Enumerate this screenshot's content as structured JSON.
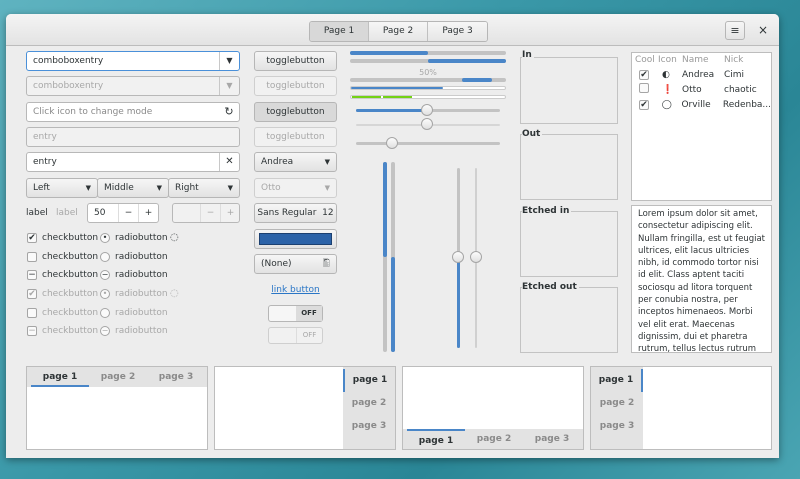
{
  "header": {
    "tabs": [
      "Page 1",
      "Page 2",
      "Page 3"
    ],
    "active_tab": 0,
    "menu_icon": "hamburger-menu-icon",
    "close_label": "×"
  },
  "col1": {
    "combo_entry": "comboboxentry",
    "combo_entry_disabled": "comboboxentry",
    "mode_entry_placeholder": "Click icon to change mode",
    "disabled_entry": "entry",
    "entry": "entry",
    "linked": [
      "Left",
      "Middle",
      "Right"
    ],
    "label1": "label",
    "label2": "label",
    "spin_value": "50",
    "spin_minus": "−",
    "spin_plus": "+",
    "checks": [
      {
        "label": "checkbutton",
        "state": "checked",
        "radio": "radiobutton",
        "radio_state": "checked",
        "spinner": true,
        "disabled": false
      },
      {
        "label": "checkbutton",
        "state": "unchecked",
        "radio": "radiobutton",
        "radio_state": "unchecked",
        "spinner": false,
        "disabled": false
      },
      {
        "label": "checkbutton",
        "state": "mixed",
        "radio": "radiobutton",
        "radio_state": "mixed",
        "spinner": false,
        "disabled": false
      },
      {
        "label": "checkbutton",
        "state": "checked",
        "radio": "radiobutton",
        "radio_state": "checked",
        "spinner": true,
        "disabled": true
      },
      {
        "label": "checkbutton",
        "state": "unchecked",
        "radio": "radiobutton",
        "radio_state": "unchecked",
        "spinner": false,
        "disabled": true
      },
      {
        "label": "checkbutton",
        "state": "mixed",
        "radio": "radiobutton",
        "radio_state": "mixed",
        "spinner": false,
        "disabled": true
      }
    ]
  },
  "col2": {
    "toggles": [
      "togglebutton",
      "togglebutton",
      "togglebutton",
      "togglebutton"
    ],
    "combo1": "Andrea",
    "combo2": "Otto",
    "font_name": "Sans Regular",
    "font_size": "12",
    "color": "#2c63a8",
    "file": "(None)",
    "link": "link button",
    "switch1": "OFF",
    "switch2": "OFF"
  },
  "col3": {
    "progress_label": "50%",
    "progress1": 0.5,
    "progress2": 0.5,
    "scale1": 0.5,
    "scale2": 0.5,
    "scale3": 0.25,
    "vscale1": 0.5,
    "vscale2": 0.5,
    "vscale3": 0.5,
    "vscale4": 0.5
  },
  "frames": [
    "In",
    "Out",
    "Etched in",
    "Etched out"
  ],
  "tree": {
    "columns": [
      "Cool",
      "Icon",
      "Name",
      "Nick"
    ],
    "rows": [
      {
        "cool": true,
        "icon": "◐",
        "name": "Andrea",
        "nick": "Cimi"
      },
      {
        "cool": false,
        "icon": "❗",
        "name": "Otto",
        "nick": "chaotic"
      },
      {
        "cool": true,
        "icon": "◯",
        "name": "Orville",
        "nick": "Redenba..."
      }
    ]
  },
  "text": "Lorem ipsum dolor sit amet, consectetur adipiscing elit. Nullam fringilla, est ut feugiat ultrices, elit lacus ultricies nibh, id commodo tortor nisi id elit. Class aptent taciti sociosqu ad litora torquent per conubia nostra, per inceptos himenaeos. Morbi vel elit erat. Maecenas dignissim, dui et pharetra rutrum, tellus lectus rutrum mi, a convallis libero nisi quis tellus. Nulla facilisi. Nullam eleifend",
  "notebooks": [
    [
      "page 1",
      "page 2",
      "page 3"
    ],
    [
      "page 1",
      "page 2",
      "page 3"
    ],
    [
      "page 1",
      "page 2",
      "page 3"
    ],
    [
      "page 1",
      "page 2",
      "page 3"
    ]
  ],
  "accent": "#4a86c8"
}
